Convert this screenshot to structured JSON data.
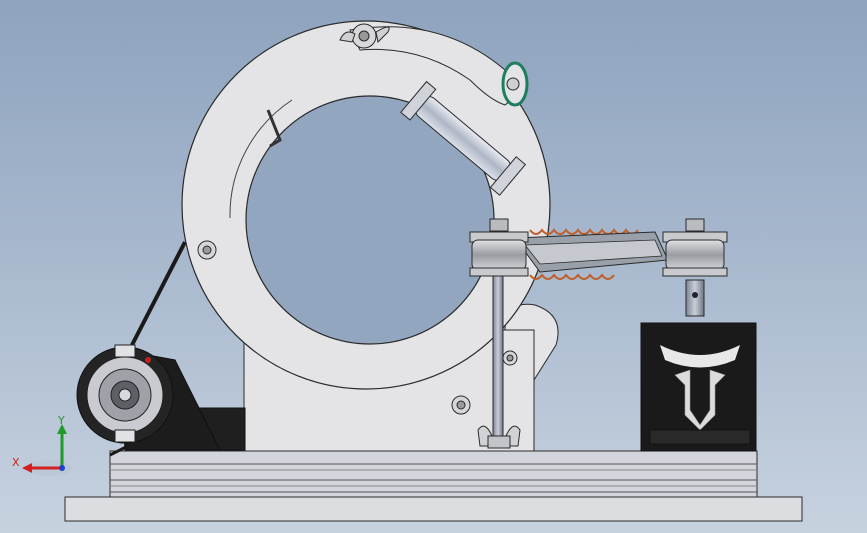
{
  "viewport": {
    "background_top": "#8ea3be",
    "background_bottom": "#c7d2df"
  },
  "triad": {
    "x_label": "X",
    "y_label": "Y",
    "x_color": "#d42020",
    "y_color": "#1f9a2a",
    "z_color": "#1f3fd0"
  },
  "model": {
    "part_color": "#e4e4e6",
    "edge_color": "#2a2a2a",
    "motor_color": "#1c1c1c",
    "spring_color": "#c0602a",
    "rail_color": "#cfd2d8",
    "accent_ring_color": "#1e7d5c"
  }
}
